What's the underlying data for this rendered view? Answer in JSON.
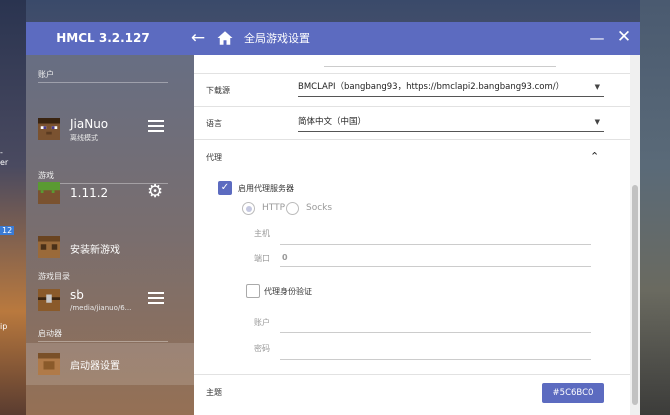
{
  "window": {
    "title": "HMCL 3.2.127",
    "page_title": "全局游戏设置"
  },
  "desktop": {
    "side_text": [
      "-",
      "er",
      "12",
      "ip"
    ]
  },
  "sidebar": {
    "account_section": "账户",
    "account": {
      "name": "JiaNuo",
      "type": "离线模式"
    },
    "game_section": "游戏",
    "version": {
      "name": "1.11.2"
    },
    "install_label": "安装新游戏",
    "folder_section": "游戏目录",
    "folder": {
      "name": "sb",
      "path": "/media/jianuo/6..."
    },
    "launcher_section": "启动器",
    "settings_label": "启动器设置"
  },
  "settings": {
    "download_source_label": "下载源",
    "download_source_value": "BMCLAPI（bangbang93，https://bmclapi2.bangbang93.com/）",
    "language_label": "语言",
    "language_value": "简体中文（中国）",
    "proxy_label": "代理",
    "enable_proxy_label": "启用代理服务器",
    "http_label": "HTTP",
    "socks_label": "Socks",
    "host_label": "主机",
    "port_label": "端口",
    "port_value": "0",
    "auth_label": "代理身份验证",
    "user_label": "账户",
    "password_label": "密码",
    "theme_label": "主题",
    "theme_value": "#5C6BC0"
  },
  "colors": {
    "accent": "#5C6BC0"
  }
}
